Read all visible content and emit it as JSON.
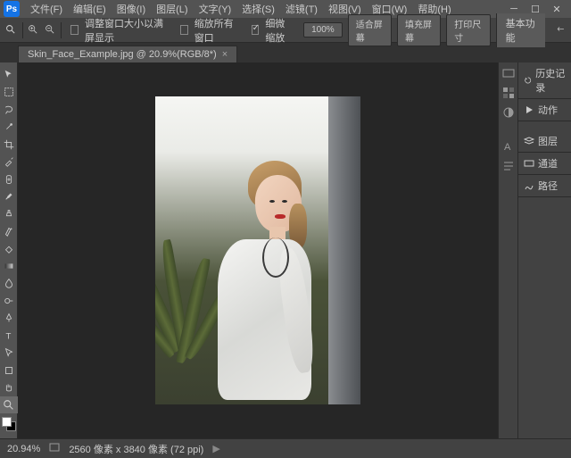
{
  "menus": [
    "文件(F)",
    "编辑(E)",
    "图像(I)",
    "图层(L)",
    "文字(Y)",
    "选择(S)",
    "滤镜(T)",
    "视图(V)",
    "窗口(W)",
    "帮助(H)"
  ],
  "optionsbar": {
    "resize_label": "调整窗口大小以满屏显示",
    "zoom_all": "缩放所有窗口",
    "scrubby": "细微缩放",
    "btns": [
      "100%",
      "适合屏幕",
      "填充屏幕",
      "打印尺寸"
    ]
  },
  "essentials": "基本功能",
  "tab": {
    "title": "Skin_Face_Example.jpg @ 20.9%(RGB/8*)"
  },
  "panels": {
    "history": "历史记录",
    "actions": "动作",
    "layers": "图层",
    "channels": "通道",
    "paths": "路径"
  },
  "status": {
    "zoom": "20.94%",
    "dims": "2560 像素 x 3840 像素 (72 ppi)"
  },
  "colors": {
    "accent": "#1473e6",
    "panel": "#535353",
    "dark": "#262626"
  }
}
